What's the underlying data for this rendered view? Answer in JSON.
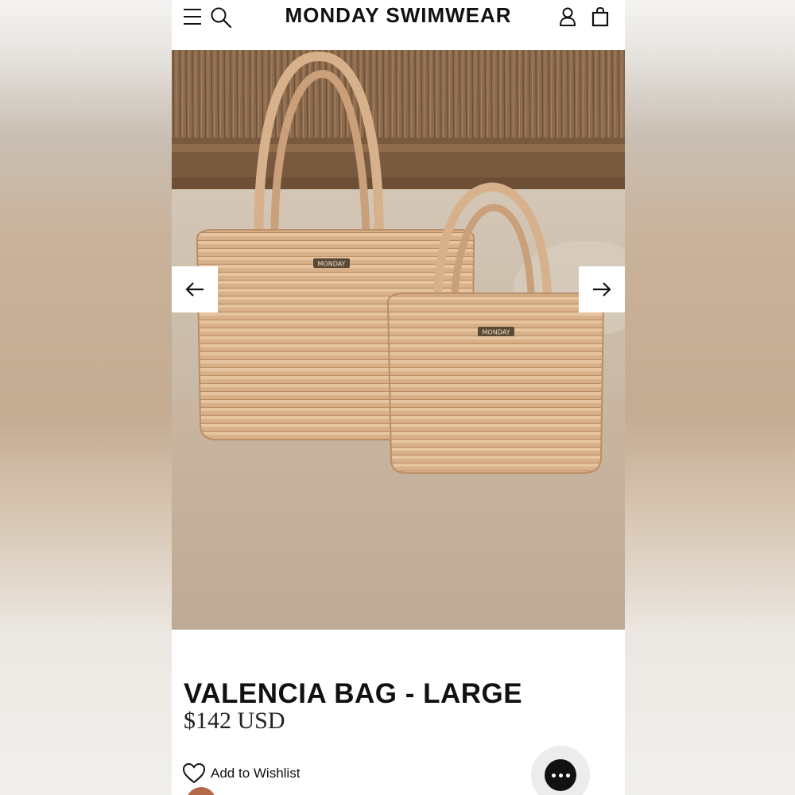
{
  "header": {
    "brand": "MONDAY SWIMWEAR",
    "icons": [
      "menu-icon",
      "search-icon",
      "account-icon",
      "shopping-bag-icon"
    ]
  },
  "gallery": {
    "bag_label_text": "MONDAY",
    "prev_icon": "arrow-left-icon",
    "next_icon": "arrow-right-icon"
  },
  "product": {
    "title": "VALENCIA BAG - LARGE",
    "price": "$142 USD",
    "wishlist_label": "Add to Wishlist"
  },
  "chat": {
    "icon": "chat-bubble-icon"
  },
  "colors": {
    "text": "#111111",
    "straw": "#d9b48e",
    "swatch": "#b5694b",
    "chat_bg": "#ececec"
  }
}
